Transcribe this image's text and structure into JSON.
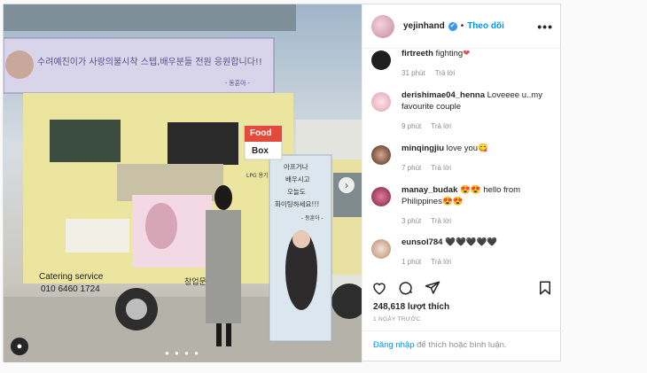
{
  "post": {
    "username": "yejinhand",
    "verified_mark": "✔",
    "separator": "•",
    "follow_label": "Theo dõi",
    "more_label": "•••",
    "likes": "248,618 lượt thích",
    "time_ago": "1 NGÀY TRƯỚC",
    "login_link": "Đăng nhập",
    "login_text": " để thích hoặc bình luận."
  },
  "photo": {
    "banner_text": "수려예진이가 사랑의불시착 스텝,배우분들 전원 응원합니다!!",
    "banner_sign": "- 동훈아 -",
    "truck_sign_top": "Food",
    "truck_sign_bottom": "Box",
    "truck_lpg": "LPG 용기",
    "truck_service": "Catering service",
    "truck_phone": "010 6460 1724",
    "truck_small": "창업문",
    "standee_text_1": "아프거나",
    "standee_text_2": "배우시고",
    "standee_text_3": "오늘도",
    "standee_text_4": "화이팅하세요!!!",
    "standee_sign": "- 동훈아 -",
    "user_tag_icon": "person-icon",
    "carousel_dots": "● ● ● ●"
  },
  "comments": [
    {
      "user": "firtreeth",
      "text": "fighting",
      "emoji": "❤",
      "time": "31 phút",
      "reply": "Trả lời"
    },
    {
      "user": "derishimae04_henna",
      "text": "Loveeee u..my favourite couple",
      "emoji": "",
      "time": "9 phút",
      "reply": "Trả lời"
    },
    {
      "user": "minqingjiu",
      "text": "love you",
      "emoji": "😋",
      "time": "7 phút",
      "reply": "Trả lời"
    },
    {
      "user": "manay_budak",
      "text": "hello from Philippines",
      "emoji_pre": "😍😍",
      "emoji": "😍😍",
      "time": "3 phút",
      "reply": "Trả lời"
    },
    {
      "user": "eunsol784",
      "text": "",
      "emoji": "🖤🖤🖤🖤🖤",
      "time": "1 phút",
      "reply": "Trả lời"
    }
  ],
  "colors": {
    "link_blue": "#0095f6",
    "truck_yellow": "#ece5a0",
    "avatar_pink": "#e2a0b0"
  }
}
